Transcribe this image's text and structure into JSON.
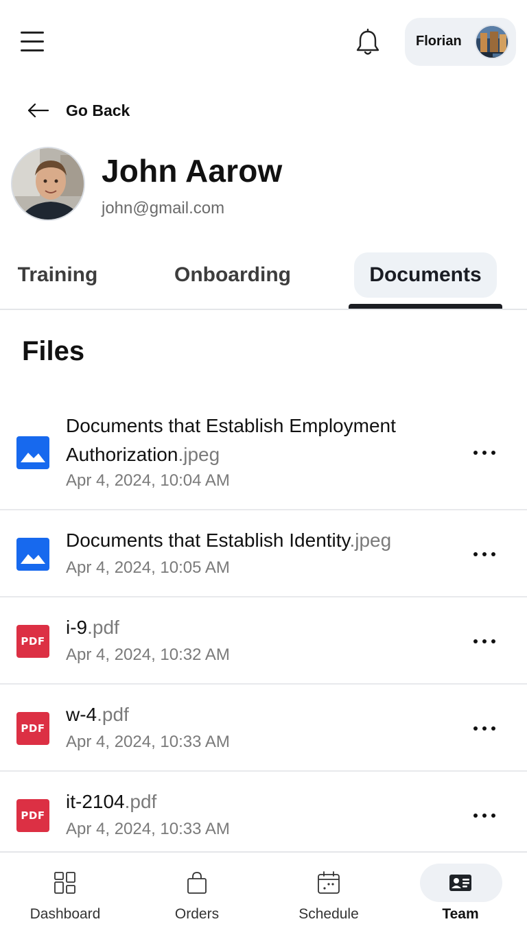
{
  "header": {
    "user_name": "Florian"
  },
  "nav": {
    "back_label": "Go Back"
  },
  "profile": {
    "name": "John Aarow",
    "email": "john@gmail.com"
  },
  "tabs": [
    {
      "label": "Training",
      "active": false
    },
    {
      "label": "Onboarding",
      "active": false
    },
    {
      "label": "Documents",
      "active": true
    }
  ],
  "files": {
    "title": "Files",
    "items": [
      {
        "name": "Documents that Establish Employment Authorization",
        "ext": ".jpeg",
        "date": "Apr 4, 2024, 10:04 AM",
        "icon": "image-icon"
      },
      {
        "name": "Documents that Establish Identity",
        "ext": ".jpeg",
        "date": "Apr 4, 2024, 10:05 AM",
        "icon": "image-icon"
      },
      {
        "name": "i-9",
        "ext": ".pdf",
        "date": "Apr 4, 2024, 10:32 AM",
        "icon": "pdf-icon",
        "icon_text": "PDF"
      },
      {
        "name": "w-4",
        "ext": ".pdf",
        "date": "Apr 4, 2024, 10:33 AM",
        "icon": "pdf-icon",
        "icon_text": "PDF"
      },
      {
        "name": "it-2104",
        "ext": ".pdf",
        "date": "Apr 4, 2024, 10:33 AM",
        "icon": "pdf-icon",
        "icon_text": "PDF"
      }
    ]
  },
  "bottom_nav": [
    {
      "label": "Dashboard",
      "icon": "dashboard-icon",
      "active": false
    },
    {
      "label": "Orders",
      "icon": "shopping-bag-icon",
      "active": false
    },
    {
      "label": "Schedule",
      "icon": "calendar-icon",
      "active": false
    },
    {
      "label": "Team",
      "icon": "id-card-icon",
      "active": true
    }
  ],
  "colors": {
    "image_icon": "#1769ee",
    "pdf_icon": "#dc3044",
    "active_tab_bg": "#eef2f6",
    "underline": "#1b1d22"
  }
}
